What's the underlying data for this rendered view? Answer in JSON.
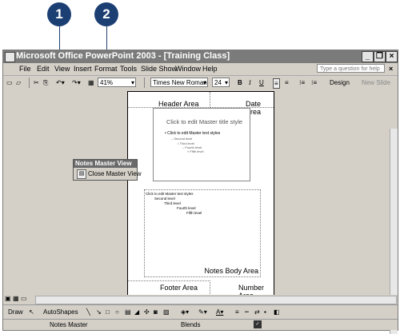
{
  "callouts": [
    "1",
    "2"
  ],
  "window": {
    "title": "Microsoft Office PowerPoint 2003 - [Training Class]",
    "minimize": "_",
    "restore": "❐",
    "close": "×"
  },
  "menu": {
    "items": [
      "File",
      "Edit",
      "View",
      "Insert",
      "Format",
      "Tools",
      "Slide Show",
      "Window",
      "Help"
    ],
    "help_placeholder": "Type a question for help"
  },
  "toolbar": {
    "zoom": "41%",
    "font_name": "Times New Roman",
    "font_size": "24",
    "bold": "B",
    "italic": "I",
    "underline": "U",
    "design": "Design",
    "new_slide": "New Slide"
  },
  "notes_page": {
    "header_area": "Header Area",
    "date_area": "Date Area",
    "footer_area": "Footer Area",
    "number_area": "Number Area",
    "notes_body_area": "Notes Body Area",
    "slide_title": "Click to edit Master title style",
    "slide_bullets": [
      "• Click to edit Master text styles",
      "– Second level",
      "• Third level",
      "– Fourth level",
      "» Fifth level"
    ],
    "body_levels": [
      "Click to edit Master text styles",
      "Second level",
      "Third level",
      "Fourth level",
      "Fifth level"
    ]
  },
  "floating_toolbar": {
    "title": "Notes Master View",
    "close_button": "Close Master View"
  },
  "drawing_toolbar": {
    "draw": "Draw",
    "autoshapes": "AutoShapes"
  },
  "status": {
    "view": "Notes Master",
    "design": "Blends"
  }
}
